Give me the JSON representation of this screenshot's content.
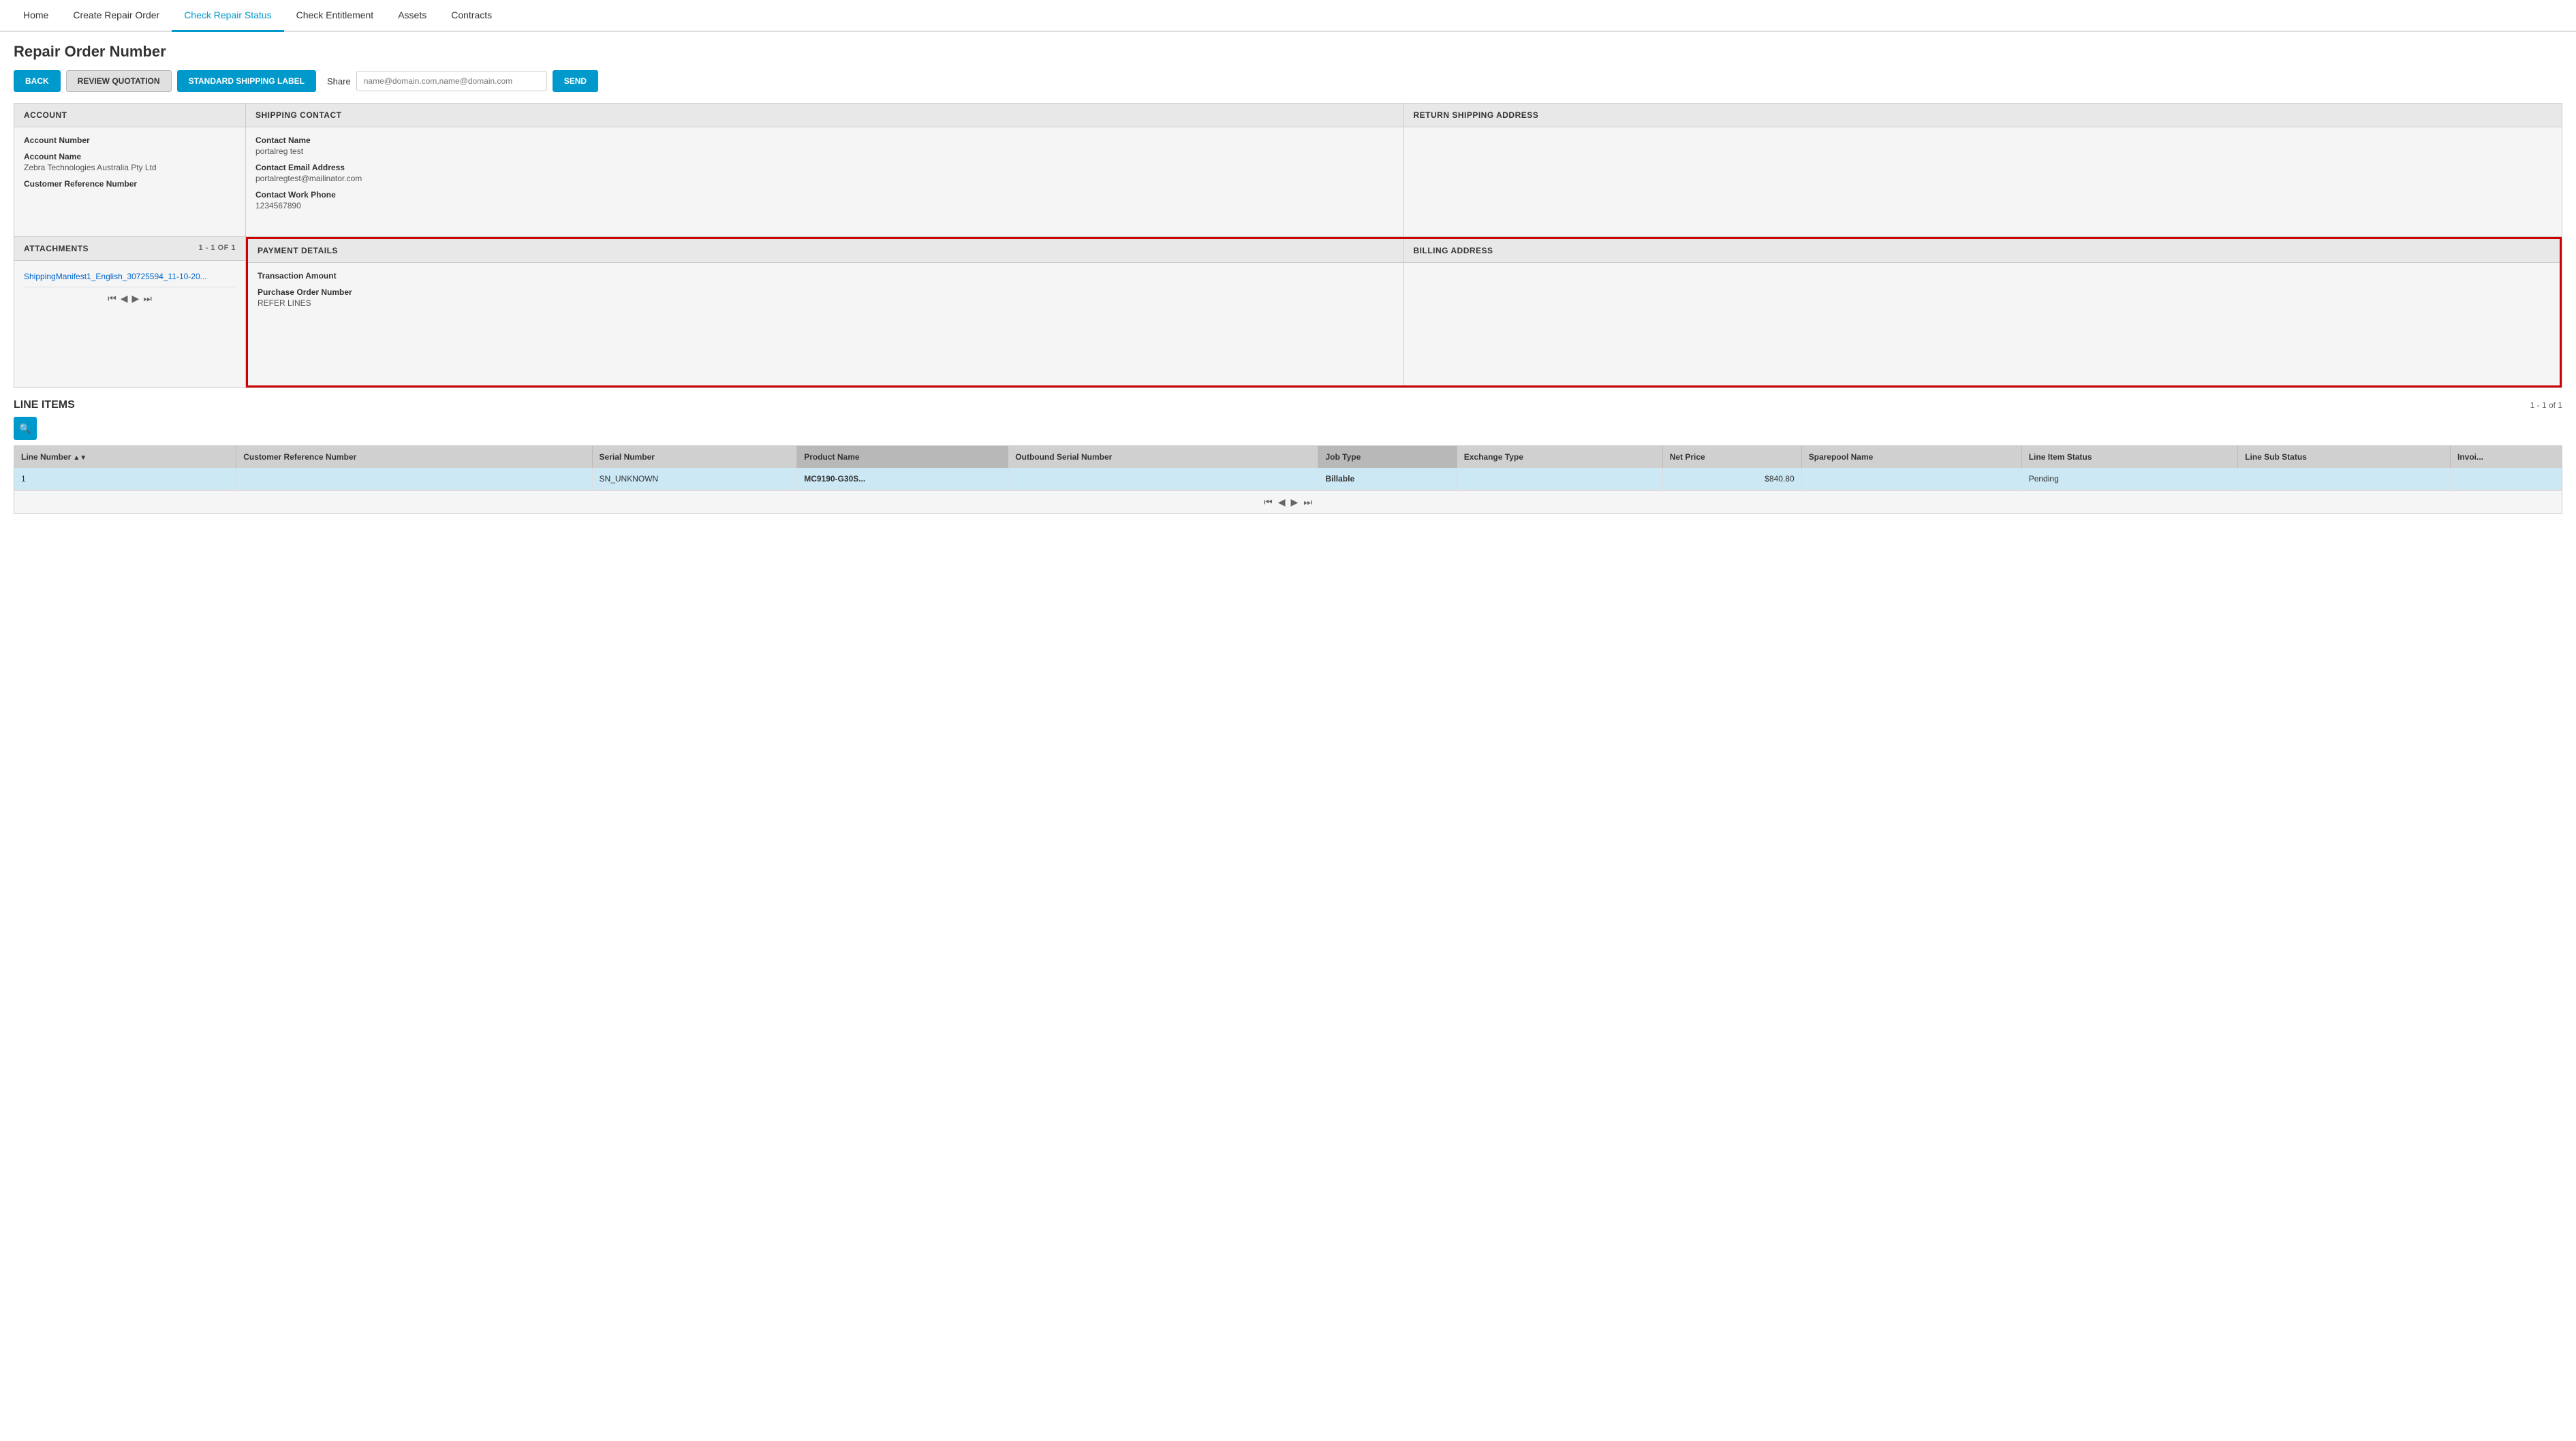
{
  "nav": {
    "items": [
      {
        "id": "home",
        "label": "Home",
        "active": false
      },
      {
        "id": "create-repair-order",
        "label": "Create Repair Order",
        "active": false
      },
      {
        "id": "check-repair-status",
        "label": "Check Repair Status",
        "active": true
      },
      {
        "id": "check-entitlement",
        "label": "Check Entitlement",
        "active": false
      },
      {
        "id": "assets",
        "label": "Assets",
        "active": false
      },
      {
        "id": "contracts",
        "label": "Contracts",
        "active": false
      }
    ]
  },
  "page": {
    "title": "Repair Order Number"
  },
  "toolbar": {
    "back_label": "BACK",
    "review_label": "REVIEW QUOTATION",
    "shipping_label": "STANDARD SHIPPING LABEL",
    "share_label": "Share",
    "share_placeholder": "name@domain.com,name@domain.com",
    "send_label": "SEND"
  },
  "account": {
    "header": "ACCOUNT",
    "fields": [
      {
        "label": "Account Number",
        "value": ""
      },
      {
        "label": "Account Name",
        "value": "Zebra Technologies Australia Pty Ltd"
      },
      {
        "label": "Customer Reference Number",
        "value": ""
      }
    ]
  },
  "shipping_contact": {
    "header": "SHIPPING CONTACT",
    "fields": [
      {
        "label": "Contact Name",
        "value": "portalreg test"
      },
      {
        "label": "Contact Email Address",
        "value": "portalregtest@mailinator.com"
      },
      {
        "label": "Contact Work Phone",
        "value": "1234567890"
      }
    ]
  },
  "return_shipping": {
    "header": "RETURN SHIPPING ADDRESS",
    "fields": []
  },
  "attachments": {
    "header": "ATTACHMENTS",
    "count": "1 - 1 of 1",
    "items": [
      {
        "label": "ShippingManifest1_English_30725594_11-10-20..."
      }
    ]
  },
  "payment": {
    "header": "PAYMENT DETAILS",
    "fields": [
      {
        "label": "Transaction Amount",
        "value": ""
      },
      {
        "label": "Purchase Order Number",
        "value": "REFER LINES"
      }
    ]
  },
  "billing": {
    "header": "BILLING ADDRESS",
    "fields": []
  },
  "line_items": {
    "title": "LINE ITEMS",
    "count": "1 - 1 of 1",
    "columns": [
      {
        "id": "line-number",
        "label": "Line Number",
        "sortable": true,
        "sort": "asc",
        "active": false
      },
      {
        "id": "customer-ref",
        "label": "Customer Reference Number",
        "sortable": false,
        "active": false
      },
      {
        "id": "serial-number",
        "label": "Serial Number",
        "sortable": false,
        "active": false
      },
      {
        "id": "product-name",
        "label": "Product Name",
        "sortable": false,
        "active": true
      },
      {
        "id": "outbound-serial",
        "label": "Outbound Serial Number",
        "sortable": false,
        "active": false
      },
      {
        "id": "job-type",
        "label": "Job Type",
        "sortable": false,
        "active": true
      },
      {
        "id": "exchange-type",
        "label": "Exchange Type",
        "sortable": false,
        "active": false
      },
      {
        "id": "net-price",
        "label": "Net Price",
        "sortable": false,
        "active": false
      },
      {
        "id": "sparepool-name",
        "label": "Sparepool Name",
        "sortable": false,
        "active": false
      },
      {
        "id": "line-item-status",
        "label": "Line Item Status",
        "sortable": false,
        "active": false
      },
      {
        "id": "line-sub-status",
        "label": "Line Sub Status",
        "sortable": false,
        "active": false
      },
      {
        "id": "invoice",
        "label": "Invoi...",
        "sortable": false,
        "active": false
      }
    ],
    "rows": [
      {
        "line_number": "1",
        "customer_ref": "",
        "serial_number": "SN_UNKNOWN",
        "product_name": "MC9190-G30S...",
        "outbound_serial": "",
        "job_type": "Billable",
        "exchange_type": "",
        "net_price": "$840.80",
        "sparepool_name": "",
        "line_item_status": "Pending",
        "line_sub_status": "",
        "invoice": ""
      }
    ],
    "pagination": {
      "icons": [
        "⏮",
        "◀",
        "▶",
        "⏭"
      ]
    }
  }
}
